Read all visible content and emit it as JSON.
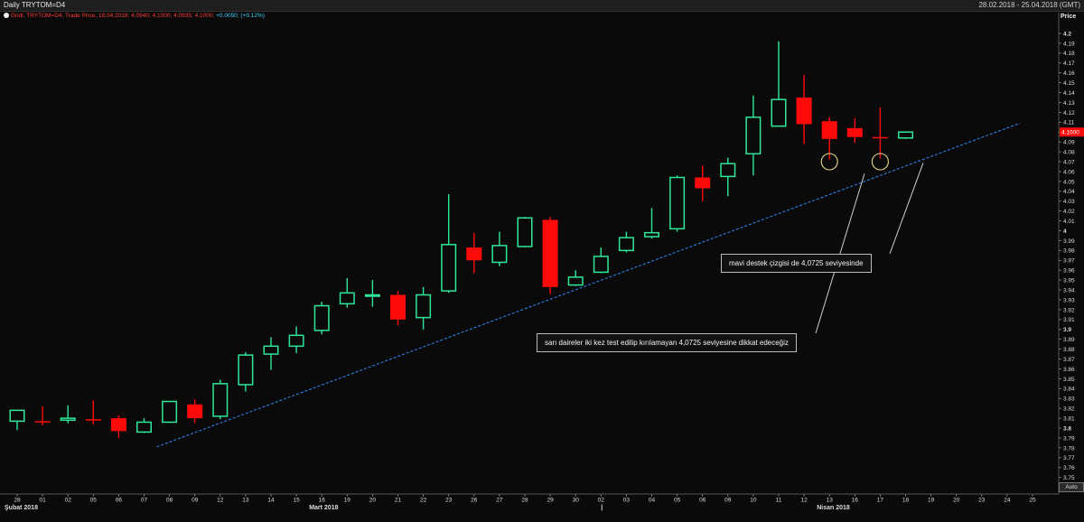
{
  "header": {
    "title": "Daily TRYTOM=D4",
    "date_range": "28.02.2018 - 25.04.2018 (GMT)"
  },
  "legend": {
    "series": "Gndl, TRYTOM=D4, Trade Price, 18.04.2018; 4.0940; 4.1000; 4.0935; 4.1000;",
    "change": "+0.0050; (+0.12%)"
  },
  "y_axis_title": "Price",
  "price_tag": "4.1000",
  "auto_label": "Auto",
  "annotations": {
    "note1": "mavi destek çizgisi de 4,0725 seviyesinde",
    "note2": "sarı daireler iki kez test edilip kırılamayan 4,0725 seviyesine dikkat edeceğiz"
  },
  "colors": {
    "background": "#0a0a0a",
    "up": "#2ee89a",
    "down": "#ff0a0a",
    "trendline": "#2f7fe8",
    "circles": "#e8d88a",
    "grid_text": "#dddddd"
  },
  "chart_data": {
    "type": "candlestick",
    "ylim": [
      3.743,
      4.205
    ],
    "y_ticks": [
      "4.2",
      "4.19",
      "4.18",
      "4.17",
      "4.16",
      "4.15",
      "4.14",
      "4.13",
      "4.12",
      "4.11",
      "4.1",
      "4.09",
      "4.08",
      "4.07",
      "4.06",
      "4.05",
      "4.04",
      "4.03",
      "4.02",
      "4.01",
      "4",
      "3.99",
      "3.98",
      "3.97",
      "3.96",
      "3.95",
      "3.94",
      "3.93",
      "3.92",
      "3.91",
      "3.9",
      "3.89",
      "3.88",
      "3.87",
      "3.86",
      "3.85",
      "3.84",
      "3.83",
      "3.82",
      "3.81",
      "3.8",
      "3.79",
      "3.78",
      "3.77",
      "3.76",
      "3.75"
    ],
    "bold_y_ticks": [
      "4.2",
      "4",
      "3.9",
      "3.8"
    ],
    "x_labels": [
      "28",
      "01",
      "02",
      "05",
      "06",
      "07",
      "08",
      "09",
      "12",
      "13",
      "14",
      "15",
      "16",
      "19",
      "20",
      "21",
      "22",
      "23",
      "26",
      "27",
      "28",
      "29",
      "30",
      "02",
      "03",
      "04",
      "05",
      "06",
      "09",
      "10",
      "11",
      "12",
      "13",
      "16",
      "17",
      "18",
      "19",
      "20",
      "23",
      "24",
      "25"
    ],
    "month_labels": [
      {
        "label": "Şubat 2018",
        "at_index": 0
      },
      {
        "label": "Mart 2018",
        "at_index": 12
      },
      {
        "label": "|",
        "at_index": 23
      },
      {
        "label": "Nisan 2018",
        "at_index": 32
      }
    ],
    "candles": [
      {
        "o": 3.807,
        "h": 3.818,
        "l": 3.798,
        "c": 3.818
      },
      {
        "o": 3.807,
        "h": 3.822,
        "l": 3.803,
        "c": 3.806
      },
      {
        "o": 3.808,
        "h": 3.823,
        "l": 3.805,
        "c": 3.81
      },
      {
        "o": 3.809,
        "h": 3.828,
        "l": 3.804,
        "c": 3.808
      },
      {
        "o": 3.81,
        "h": 3.813,
        "l": 3.79,
        "c": 3.797
      },
      {
        "o": 3.796,
        "h": 3.81,
        "l": 3.795,
        "c": 3.806
      },
      {
        "o": 3.806,
        "h": 3.827,
        "l": 3.805,
        "c": 3.827
      },
      {
        "o": 3.824,
        "h": 3.829,
        "l": 3.805,
        "c": 3.81
      },
      {
        "o": 3.812,
        "h": 3.849,
        "l": 3.809,
        "c": 3.845
      },
      {
        "o": 3.844,
        "h": 3.877,
        "l": 3.837,
        "c": 3.874
      },
      {
        "o": 3.875,
        "h": 3.892,
        "l": 3.859,
        "c": 3.883
      },
      {
        "o": 3.883,
        "h": 3.903,
        "l": 3.876,
        "c": 3.894
      },
      {
        "o": 3.899,
        "h": 3.928,
        "l": 3.895,
        "c": 3.924
      },
      {
        "o": 3.926,
        "h": 3.952,
        "l": 3.922,
        "c": 3.937
      },
      {
        "o": 3.935,
        "h": 3.95,
        "l": 3.923,
        "c": 3.935
      },
      {
        "o": 3.935,
        "h": 3.939,
        "l": 3.904,
        "c": 3.91
      },
      {
        "o": 3.912,
        "h": 3.943,
        "l": 3.9,
        "c": 3.935
      },
      {
        "o": 3.939,
        "h": 4.037,
        "l": 3.937,
        "c": 3.986
      },
      {
        "o": 3.983,
        "h": 3.998,
        "l": 3.957,
        "c": 3.97
      },
      {
        "o": 3.968,
        "h": 3.999,
        "l": 3.964,
        "c": 3.985
      },
      {
        "o": 3.984,
        "h": 4.014,
        "l": 3.983,
        "c": 4.013
      },
      {
        "o": 4.011,
        "h": 4.014,
        "l": 3.936,
        "c": 3.943
      },
      {
        "o": 3.945,
        "h": 3.96,
        "l": 3.944,
        "c": 3.953
      },
      {
        "o": 3.958,
        "h": 3.983,
        "l": 3.957,
        "c": 3.974
      },
      {
        "o": 3.98,
        "h": 3.999,
        "l": 3.978,
        "c": 3.993
      },
      {
        "o": 3.994,
        "h": 4.023,
        "l": 3.992,
        "c": 3.998
      },
      {
        "o": 4.002,
        "h": 4.056,
        "l": 3.999,
        "c": 4.054
      },
      {
        "o": 4.054,
        "h": 4.066,
        "l": 4.03,
        "c": 4.043
      },
      {
        "o": 4.055,
        "h": 4.074,
        "l": 4.035,
        "c": 4.068
      },
      {
        "o": 4.078,
        "h": 4.137,
        "l": 4.056,
        "c": 4.115
      },
      {
        "o": 4.106,
        "h": 4.192,
        "l": 4.106,
        "c": 4.133
      },
      {
        "o": 4.135,
        "h": 4.158,
        "l": 4.088,
        "c": 4.108
      },
      {
        "o": 4.111,
        "h": 4.115,
        "l": 4.072,
        "c": 4.093
      },
      {
        "o": 4.104,
        "h": 4.114,
        "l": 4.089,
        "c": 4.095
      },
      {
        "o": 4.095,
        "h": 4.125,
        "l": 4.073,
        "c": 4.094
      },
      {
        "o": 4.094,
        "h": 4.1,
        "l": 4.093,
        "c": 4.1
      }
    ],
    "trendline": {
      "start": {
        "index": 5.5,
        "price": 3.781
      },
      "end": {
        "index": 39.5,
        "price": 4.109
      }
    },
    "support_level": 4.0725,
    "circles": [
      {
        "index": 32,
        "price": 4.07
      },
      {
        "index": 34,
        "price": 4.07
      }
    ]
  }
}
